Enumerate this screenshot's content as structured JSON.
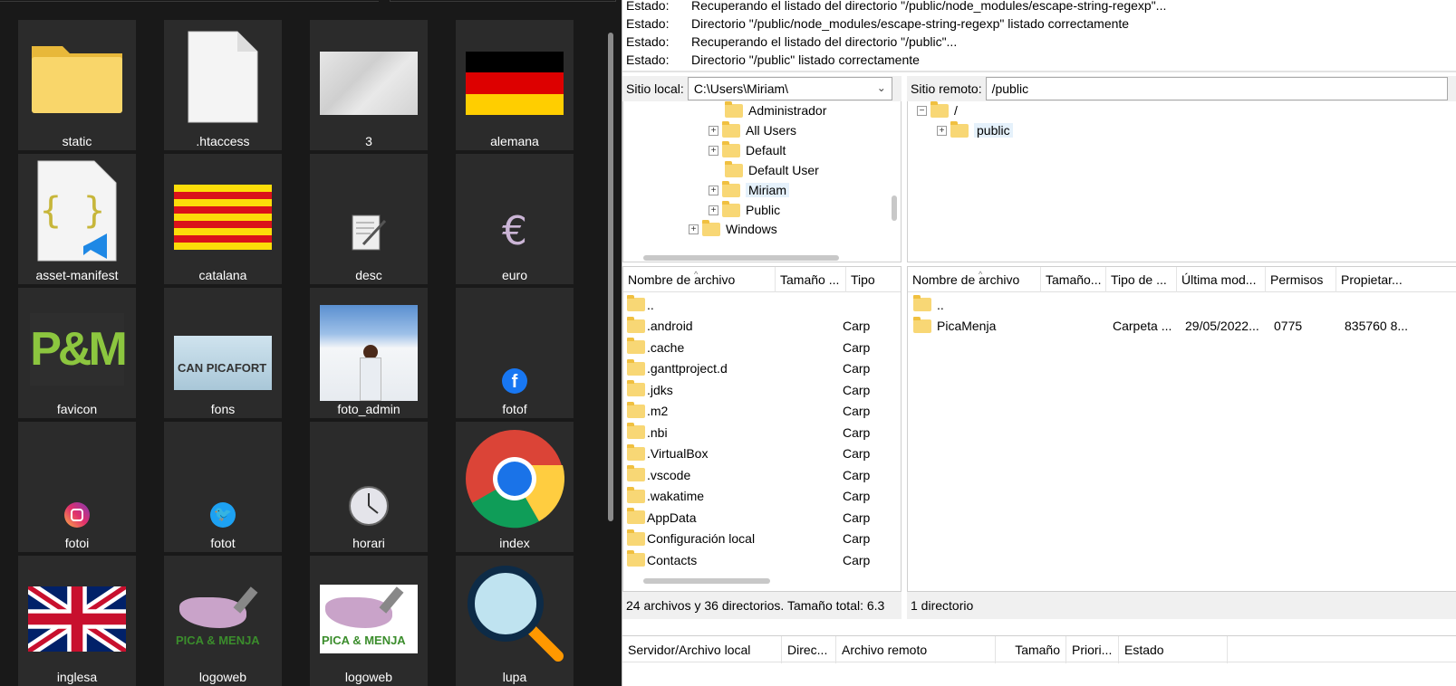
{
  "explorer": {
    "tiles": [
      {
        "label": "static",
        "icon": "folder-icon"
      },
      {
        "label": ".htaccess",
        "icon": "blank-file-icon"
      },
      {
        "label": "3",
        "icon": "marble-texture-image"
      },
      {
        "label": "alemana",
        "icon": "germany-flag-image"
      },
      {
        "label": "asset-manifest",
        "icon": "json-file-icon"
      },
      {
        "label": "catalana",
        "icon": "catalonia-flag-image"
      },
      {
        "label": "desc",
        "icon": "document-pen-icon"
      },
      {
        "label": "euro",
        "icon": "euro-icon"
      },
      {
        "label": "favicon",
        "icon": "pm-logo-image"
      },
      {
        "label": "fons",
        "icon": "can-picafort-image"
      },
      {
        "label": "foto_admin",
        "icon": "person-snow-photo"
      },
      {
        "label": "fotof",
        "icon": "facebook-icon"
      },
      {
        "label": "fotoi",
        "icon": "instagram-icon"
      },
      {
        "label": "fotot",
        "icon": "twitter-icon"
      },
      {
        "label": "horari",
        "icon": "clock-icon"
      },
      {
        "label": "index",
        "icon": "chrome-icon"
      },
      {
        "label": "inglesa",
        "icon": "uk-flag-image"
      },
      {
        "label": "logoweb",
        "icon": "picamenja-logo-image"
      },
      {
        "label": "logoweb",
        "icon": "picamenja-logo-image"
      },
      {
        "label": "lupa",
        "icon": "magnifier-icon"
      }
    ],
    "logo_text_pm": "P&M",
    "logo_text_pica": "PICA & MENJA",
    "fons_text": "CAN PICAFORT"
  },
  "log": [
    {
      "k": "Estado:",
      "v": "Recuperando el listado del directorio \"/public/node_modules/escape-string-regexp\"..."
    },
    {
      "k": "Estado:",
      "v": "Directorio \"/public/node_modules/escape-string-regexp\" listado correctamente"
    },
    {
      "k": "Estado:",
      "v": "Recuperando el listado del directorio \"/public\"..."
    },
    {
      "k": "Estado:",
      "v": "Directorio \"/public\" listado correctamente"
    }
  ],
  "local": {
    "site_label": "Sitio local:",
    "path": "C:\\Users\\Miriam\\",
    "tree": [
      {
        "name": "Administrador",
        "expandable": false
      },
      {
        "name": "All Users",
        "expandable": true
      },
      {
        "name": "Default",
        "expandable": true
      },
      {
        "name": "Default User",
        "expandable": false
      },
      {
        "name": "Miriam",
        "expandable": true,
        "selected": true
      },
      {
        "name": "Public",
        "expandable": true
      },
      {
        "name": "Windows",
        "expandable": true
      }
    ],
    "columns": [
      "Nombre de archivo",
      "Tamaño ...",
      "Tipo"
    ],
    "files": [
      {
        "name": "..",
        "type": ""
      },
      {
        "name": ".android",
        "type": "Carpeta"
      },
      {
        "name": ".cache",
        "type": "Carpeta"
      },
      {
        "name": ".ganttproject.d",
        "type": "Carpeta"
      },
      {
        "name": ".jdks",
        "type": "Carpeta"
      },
      {
        "name": ".m2",
        "type": "Carpeta"
      },
      {
        "name": ".nbi",
        "type": "Carpeta"
      },
      {
        "name": ".VirtualBox",
        "type": "Carpeta"
      },
      {
        "name": ".vscode",
        "type": "Carpeta"
      },
      {
        "name": ".wakatime",
        "type": "Carpeta"
      },
      {
        "name": "AppData",
        "type": "Carpeta"
      },
      {
        "name": "Configuración local",
        "type": "Carpeta"
      },
      {
        "name": "Contacts",
        "type": "Carpeta"
      }
    ],
    "status": "24 archivos y 36 directorios. Tamaño total: 6.3"
  },
  "remote": {
    "site_label": "Sitio remoto:",
    "path": "/public",
    "tree": [
      {
        "name": "/",
        "expandable": false,
        "expanded": true
      },
      {
        "name": "public",
        "expandable": true,
        "selected": true
      }
    ],
    "columns": [
      "Nombre de archivo",
      "Tamaño...",
      "Tipo de ...",
      "Última mod...",
      "Permisos",
      "Propietar..."
    ],
    "files": [
      {
        "name": "..",
        "size": "",
        "type": "",
        "modified": "",
        "perms": "",
        "owner": ""
      },
      {
        "name": "PicaMenja",
        "size": "",
        "type": "Carpeta ...",
        "modified": "29/05/2022...",
        "perms": "0775",
        "owner": "835760 8..."
      }
    ],
    "status": "1 directorio"
  },
  "queue": {
    "columns": [
      "Servidor/Archivo local",
      "Direc...",
      "Archivo remoto",
      "Tamaño",
      "Priori...",
      "Estado"
    ]
  }
}
